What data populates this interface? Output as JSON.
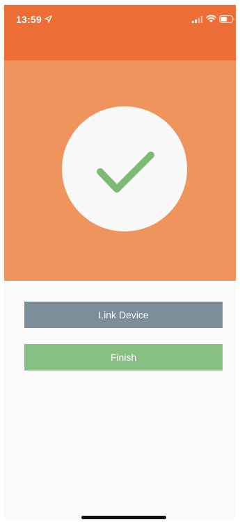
{
  "status_bar": {
    "time": "13:59",
    "background": "#ec6e36",
    "icons": [
      "location-arrow-icon",
      "signal-icon",
      "wifi-icon",
      "battery-icon"
    ]
  },
  "hero": {
    "background": "#f0945e",
    "icon": "checkmark-icon",
    "icon_color": "#7dbb74"
  },
  "actions": {
    "link_device_label": "Link Device",
    "link_device_color": "#7b8e9a",
    "finish_label": "Finish",
    "finish_color": "#88c083"
  }
}
